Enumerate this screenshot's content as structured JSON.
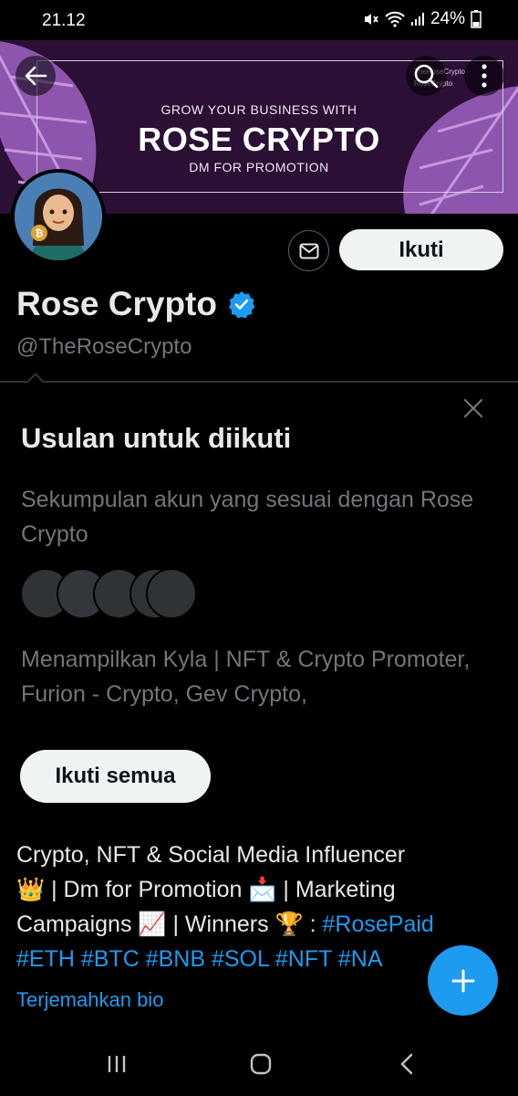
{
  "status_bar": {
    "time": "21.12",
    "battery": "24%"
  },
  "banner": {
    "top_text": "GROW YOUR BUSINESS WITH",
    "main_text": "ROSE CRYPTO",
    "sub_text": "DM FOR PROMOTION",
    "social_1": "TheRoseCrypto",
    "social_2": "RoseCrypto"
  },
  "profile": {
    "name": "Rose Crypto",
    "handle": "@TheRoseCrypto",
    "verified": true,
    "follow_label": "Ikuti"
  },
  "suggestions": {
    "title": "Usulan untuk diikuti",
    "description": "Sekumpulan akun yang sesuai dengan Rose Crypto",
    "accounts_text": "Menampilkan Kyla | NFT & Crypto Promoter, Furion - Crypto, Gev Crypto,",
    "follow_all_label": "Ikuti semua"
  },
  "bio": {
    "line1": "Crypto, NFT & Social Media Influencer",
    "line2_a": "👑 | Dm for Promotion 📩 | Marketing",
    "line3_a": "Campaigns 📈 | Winners 🏆 : ",
    "line3_tag": "#RosePaid",
    "line4_tags": "#ETH #BTC #BNB #SOL #NFT #NA",
    "translate_label": "Terjemahkan bio"
  },
  "colors": {
    "accent": "#1d9bf0",
    "banner_bg": "#2b0f35",
    "leaf": "#a56bc6",
    "muted_text": "#71767b"
  },
  "icons": {
    "back": "arrow-left-icon",
    "search": "search-icon",
    "more": "more-vertical-icon",
    "message": "mail-icon",
    "verified": "verified-badge-icon",
    "close": "close-icon",
    "compose": "plus-icon"
  }
}
